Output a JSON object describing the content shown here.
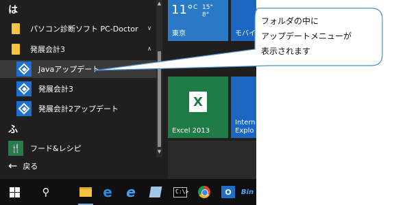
{
  "start_menu": {
    "group_ha": "は",
    "group_fu": "ふ",
    "apps": [
      {
        "label": "パソコン診断ソフト PC-Doctor",
        "icon": "folder-icon",
        "chevron": "∨"
      },
      {
        "label": "発展会計3",
        "icon": "folder-icon",
        "chevron": "∧"
      },
      {
        "label": "Javaアップデート",
        "icon": "kaikei-icon"
      },
      {
        "label": "発展会計3",
        "icon": "kaikei-icon"
      },
      {
        "label": "発展会計2アップデート",
        "icon": "kaikei-icon"
      },
      {
        "label": "フード&レシピ",
        "icon": "food-icon"
      }
    ],
    "back_label": "戻る"
  },
  "tiles": {
    "weather": {
      "temp": "11°",
      "unit": "C",
      "range_hi": "15°",
      "range_lo": "8°",
      "city": "東京"
    },
    "mobile_label": "モバイ",
    "excel_label": "Excel 2013",
    "ie_label_line1": "Intern",
    "ie_label_line2": "Explo"
  },
  "callout": {
    "line1": "フォルダの中に",
    "line2": "アップデートメニューが",
    "line3": "表示されます"
  },
  "taskbar": {
    "cmd_text": "C:\\>",
    "outlook_text": "O",
    "bin_text": "Bin"
  },
  "colors": {
    "menu_bg": "#1f1f1f",
    "selected_row": "#3a3a3a",
    "weather_tile": "#2a79c7",
    "excel_tile": "#1e7b45",
    "ie_tile": "#1b66c0",
    "taskbar_bg": "#101010"
  }
}
